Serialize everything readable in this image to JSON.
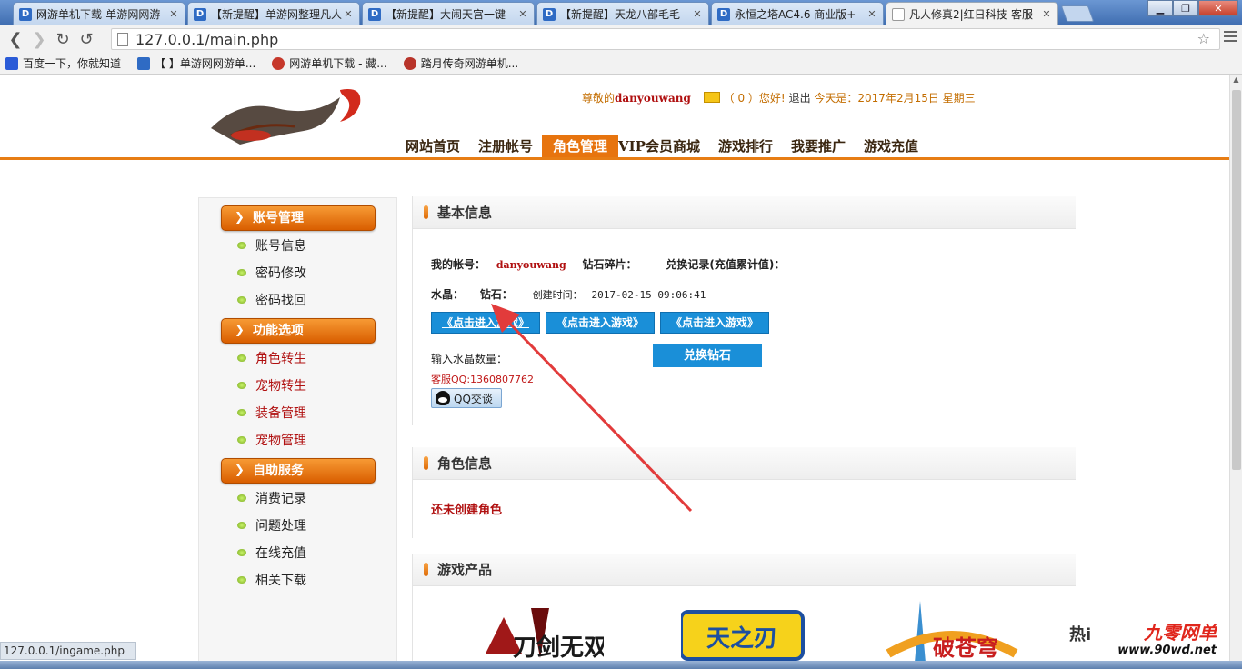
{
  "browser": {
    "tabs": [
      {
        "title": "网游单机下载-单游网网游",
        "active": false
      },
      {
        "title": "【新提醒】单游网整理凡人",
        "active": false
      },
      {
        "title": "【新提醒】大闹天宫一键",
        "active": false
      },
      {
        "title": "【新提醒】天龙八部毛毛",
        "active": false
      },
      {
        "title": "永恒之塔AC4.6 商业版+",
        "active": false
      },
      {
        "title": "凡人修真2|红日科技-客服",
        "active": true
      }
    ],
    "url": "127.0.0.1/main.php",
    "bookmarks": [
      {
        "label": "百度一下，你就知道",
        "color": "#2a5bd7"
      },
      {
        "label": "【 】单游网网游单...",
        "color": "#2f6bc4"
      },
      {
        "label": "网游单机下载 - 藏...",
        "color": "#c6382b"
      },
      {
        "label": "踏月传奇网游单机...",
        "color": "#b8342a"
      }
    ],
    "status_url": "127.0.0.1/ingame.php"
  },
  "header": {
    "greeting_prefix": "尊敬的",
    "username": "danyouwang",
    "mail_count": "（ 0 ）您好!",
    "logout": "退出",
    "date_text": "今天是：2017年2月15日 星期三"
  },
  "nav": [
    {
      "label": "网站首页",
      "active": false
    },
    {
      "label": "注册帐号",
      "active": false
    },
    {
      "label": "角色管理",
      "active": true
    },
    {
      "label": "VIP会员商城",
      "active": false
    },
    {
      "label": "游戏排行",
      "active": false
    },
    {
      "label": "我要推广",
      "active": false
    },
    {
      "label": "游戏充值",
      "active": false
    }
  ],
  "sidebar": {
    "sections": [
      {
        "title": "账号管理",
        "items": [
          {
            "label": "账号信息",
            "red": false
          },
          {
            "label": "密码修改",
            "red": false
          },
          {
            "label": "密码找回",
            "red": false
          }
        ]
      },
      {
        "title": "功能选项",
        "items": [
          {
            "label": "角色转生",
            "red": true
          },
          {
            "label": "宠物转生",
            "red": true
          },
          {
            "label": "装备管理",
            "red": true
          },
          {
            "label": "宠物管理",
            "red": true
          }
        ]
      },
      {
        "title": "自助服务",
        "items": [
          {
            "label": "消费记录",
            "red": false
          },
          {
            "label": "问题处理",
            "red": false
          },
          {
            "label": "在线充值",
            "red": false
          },
          {
            "label": "相关下载",
            "red": false
          }
        ]
      }
    ]
  },
  "basic_info": {
    "title": "基本信息",
    "account_label": "我的帐号：",
    "account_value": "danyouwang",
    "diamond_frag_label": "钻石碎片：",
    "exchange_record_label": "兑换记录(充值累计值)：",
    "crystal_label": "水晶：",
    "diamond_label": "钻石：",
    "created_label": "创建时间：",
    "created_value": "2017-02-15 09:06:41",
    "enter_game_buttons": [
      "《点击进入游戏》",
      "《点击进入游戏》",
      "《点击进入游戏》"
    ],
    "input_crystal_label": "输入水晶数量：",
    "exchange_button": "兑换钻石",
    "service_qq": "客服QQ:1360807762",
    "qq_chat_button": "QQ交谈"
  },
  "role_info": {
    "title": "角色信息",
    "empty_text": "还未创建角色"
  },
  "game_products": {
    "title": "游戏产品",
    "games": [
      "刀剑无双",
      "天之刃",
      "破苍穹"
    ]
  },
  "watermark": {
    "hot": "热i",
    "brand": "九零网单",
    "url": "www.90wd.net"
  },
  "colors": {
    "accent_orange": "#e7740e",
    "button_blue": "#1a8fd8",
    "text_red": "#b01010"
  }
}
